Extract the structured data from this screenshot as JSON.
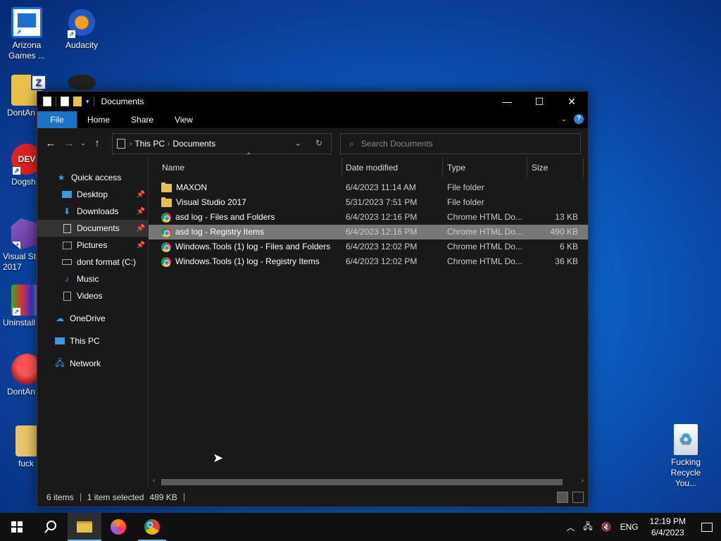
{
  "desktop": {
    "icons": [
      {
        "label": "Arizona Games ...",
        "icon": "arizona-games-icon"
      },
      {
        "label": "Audacity",
        "icon": "audacity-icon"
      },
      {
        "label": "DontAn",
        "icon": "zip-folder-icon"
      },
      {
        "label": "Dogsh",
        "icon": "dev-cpp-icon"
      },
      {
        "label": "Visual St 2017",
        "icon": "visual-studio-icon"
      },
      {
        "label": "Uninstall",
        "icon": "uninstall-icon"
      },
      {
        "label": "DontAn",
        "icon": "mascot-icon"
      },
      {
        "label": "fuck",
        "icon": "folder-icon"
      },
      {
        "label": "Fucking Recycle You...",
        "icon": "recycle-bin-icon"
      }
    ]
  },
  "window": {
    "title": "Documents",
    "controls": {
      "minimize": "—",
      "maximize": "☐",
      "close": "✕"
    },
    "ribbon": {
      "tabs": [
        "File",
        "Home",
        "Share",
        "View"
      ]
    },
    "address": {
      "crumbs": [
        "This PC",
        "Documents"
      ]
    },
    "search": {
      "placeholder": "Search Documents"
    },
    "nav": {
      "quick_access": "Quick access",
      "items": [
        {
          "label": "Desktop",
          "pinned": true
        },
        {
          "label": "Downloads",
          "pinned": true
        },
        {
          "label": "Documents",
          "pinned": true,
          "selected": true
        },
        {
          "label": "Pictures",
          "pinned": true
        },
        {
          "label": "dont format (C:)"
        },
        {
          "label": "Music"
        },
        {
          "label": "Videos"
        }
      ],
      "onedrive": "OneDrive",
      "this_pc": "This PC",
      "network": "Network"
    },
    "columns": {
      "name": "Name",
      "date": "Date modified",
      "type": "Type",
      "size": "Size"
    },
    "files": [
      {
        "name": "MAXON",
        "date": "6/4/2023 11:14 AM",
        "type": "File folder",
        "size": "",
        "kind": "folder"
      },
      {
        "name": "Visual Studio 2017",
        "date": "5/31/2023 7:51 PM",
        "type": "File folder",
        "size": "",
        "kind": "folder"
      },
      {
        "name": "asd log - Files and Folders",
        "date": "6/4/2023 12:16 PM",
        "type": "Chrome HTML Do...",
        "size": "13 KB",
        "kind": "chrome"
      },
      {
        "name": "asd log - Registry Items",
        "date": "6/4/2023 12:16 PM",
        "type": "Chrome HTML Do...",
        "size": "490 KB",
        "kind": "chrome",
        "selected": true
      },
      {
        "name": "Windows.Tools (1) log - Files and Folders",
        "date": "6/4/2023 12:02 PM",
        "type": "Chrome HTML Do...",
        "size": "6 KB",
        "kind": "chrome"
      },
      {
        "name": "Windows.Tools (1) log - Registry Items",
        "date": "6/4/2023 12:02 PM",
        "type": "Chrome HTML Do...",
        "size": "36 KB",
        "kind": "chrome"
      }
    ],
    "status": {
      "items": "6 items",
      "selected": "1 item selected",
      "size": "489 KB"
    }
  },
  "taskbar": {
    "lang": "ENG",
    "time": "12:19 PM",
    "date": "6/4/2023"
  }
}
